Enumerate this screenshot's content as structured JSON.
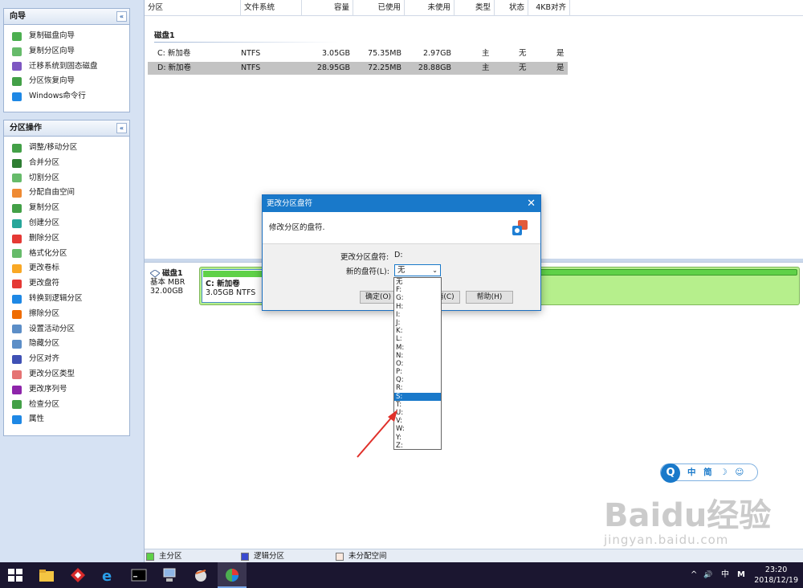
{
  "sidebar": {
    "wizard": {
      "title": "向导",
      "collapse": "«",
      "items": [
        {
          "label": "复制磁盘向导",
          "color": "#4caf50"
        },
        {
          "label": "复制分区向导",
          "color": "#66bb6a"
        },
        {
          "label": "迁移系统到固态磁盘",
          "color": "#7e57c2"
        },
        {
          "label": "分区恢复向导",
          "color": "#43a047"
        },
        {
          "label": "Windows命令行",
          "color": "#1e88e5"
        }
      ]
    },
    "ops": {
      "title": "分区操作",
      "collapse": "«",
      "items": [
        {
          "label": "调整/移动分区",
          "color": "#43a047"
        },
        {
          "label": "合并分区",
          "color": "#2e7d32"
        },
        {
          "label": "切割分区",
          "color": "#66bb6a"
        },
        {
          "label": "分配自由空间",
          "color": "#ef8a33"
        },
        {
          "label": "复制分区",
          "color": "#43a047"
        },
        {
          "label": "创建分区",
          "color": "#26a69a"
        },
        {
          "label": "删除分区",
          "color": "#e53935"
        },
        {
          "label": "格式化分区",
          "color": "#66bb6a"
        },
        {
          "label": "更改卷标",
          "color": "#f9a825"
        },
        {
          "label": "更改盘符",
          "color": "#e53935"
        },
        {
          "label": "转换到逻辑分区",
          "color": "#1e88e5"
        },
        {
          "label": "擦除分区",
          "color": "#ef6c00"
        },
        {
          "label": "设置活动分区",
          "color": "#5c8ec7"
        },
        {
          "label": "隐藏分区",
          "color": "#5c8ec7"
        },
        {
          "label": "分区对齐",
          "color": "#3f51b5"
        },
        {
          "label": "更改分区类型",
          "color": "#e57373"
        },
        {
          "label": "更改序列号",
          "color": "#8e24aa"
        },
        {
          "label": "检查分区",
          "color": "#43a047"
        },
        {
          "label": "属性",
          "color": "#1e88e5"
        }
      ]
    }
  },
  "table": {
    "headers": [
      "分区",
      "文件系统",
      "容量",
      "已使用",
      "未使用",
      "类型",
      "状态",
      "4KB对齐"
    ],
    "disk_label": "磁盘1",
    "rows": [
      [
        "C: 新加卷",
        "NTFS",
        "3.05GB",
        "75.35MB",
        "2.97GB",
        "主",
        "无",
        "是"
      ],
      [
        "D: 新加卷",
        "NTFS",
        "28.95GB",
        "72.25MB",
        "28.88GB",
        "主",
        "无",
        "是"
      ]
    ]
  },
  "diskmap": {
    "name": "磁盘1",
    "type": "基本 MBR",
    "size": "32.00GB",
    "partition_name": "C: 新加卷",
    "partition_info": "3.05GB NTFS"
  },
  "legend": {
    "primary": "主分区",
    "logical": "逻辑分区",
    "unallocated": "未分配空间",
    "primary_color": "#5fd148",
    "logical_color": "#3a4bd0",
    "unallocated_color": "#fbe9df"
  },
  "dialog": {
    "title": "更改分区盘符",
    "close": "✕",
    "description": "修改分区的盘符.",
    "current_label": "更改分区盘符:",
    "current_value": "D:",
    "new_label": "新的盘符(L):",
    "new_value": "无",
    "ok": "确定(O)",
    "cancel": "取消(C)",
    "help": "帮助(H)"
  },
  "dropdown": {
    "options": [
      "无",
      "F:",
      "G:",
      "H:",
      "I:",
      "J:",
      "K:",
      "L:",
      "M:",
      "N:",
      "O:",
      "P:",
      "Q:",
      "R:",
      "S:",
      "T:",
      "U:",
      "V:",
      "W:",
      "Y:",
      "Z:"
    ],
    "highlighted": "S:"
  },
  "ime": {
    "logo": "Q",
    "text": "中 简 ☽ ☺"
  },
  "watermark": {
    "brand": "Baidu经验",
    "url": "jingyan.baidu.com"
  },
  "taskbar": {
    "tray_up": "^",
    "volume": "🔊",
    "ime_lang": "中",
    "ime_mode": "M",
    "time": "23:20",
    "date": "2018/12/19"
  }
}
